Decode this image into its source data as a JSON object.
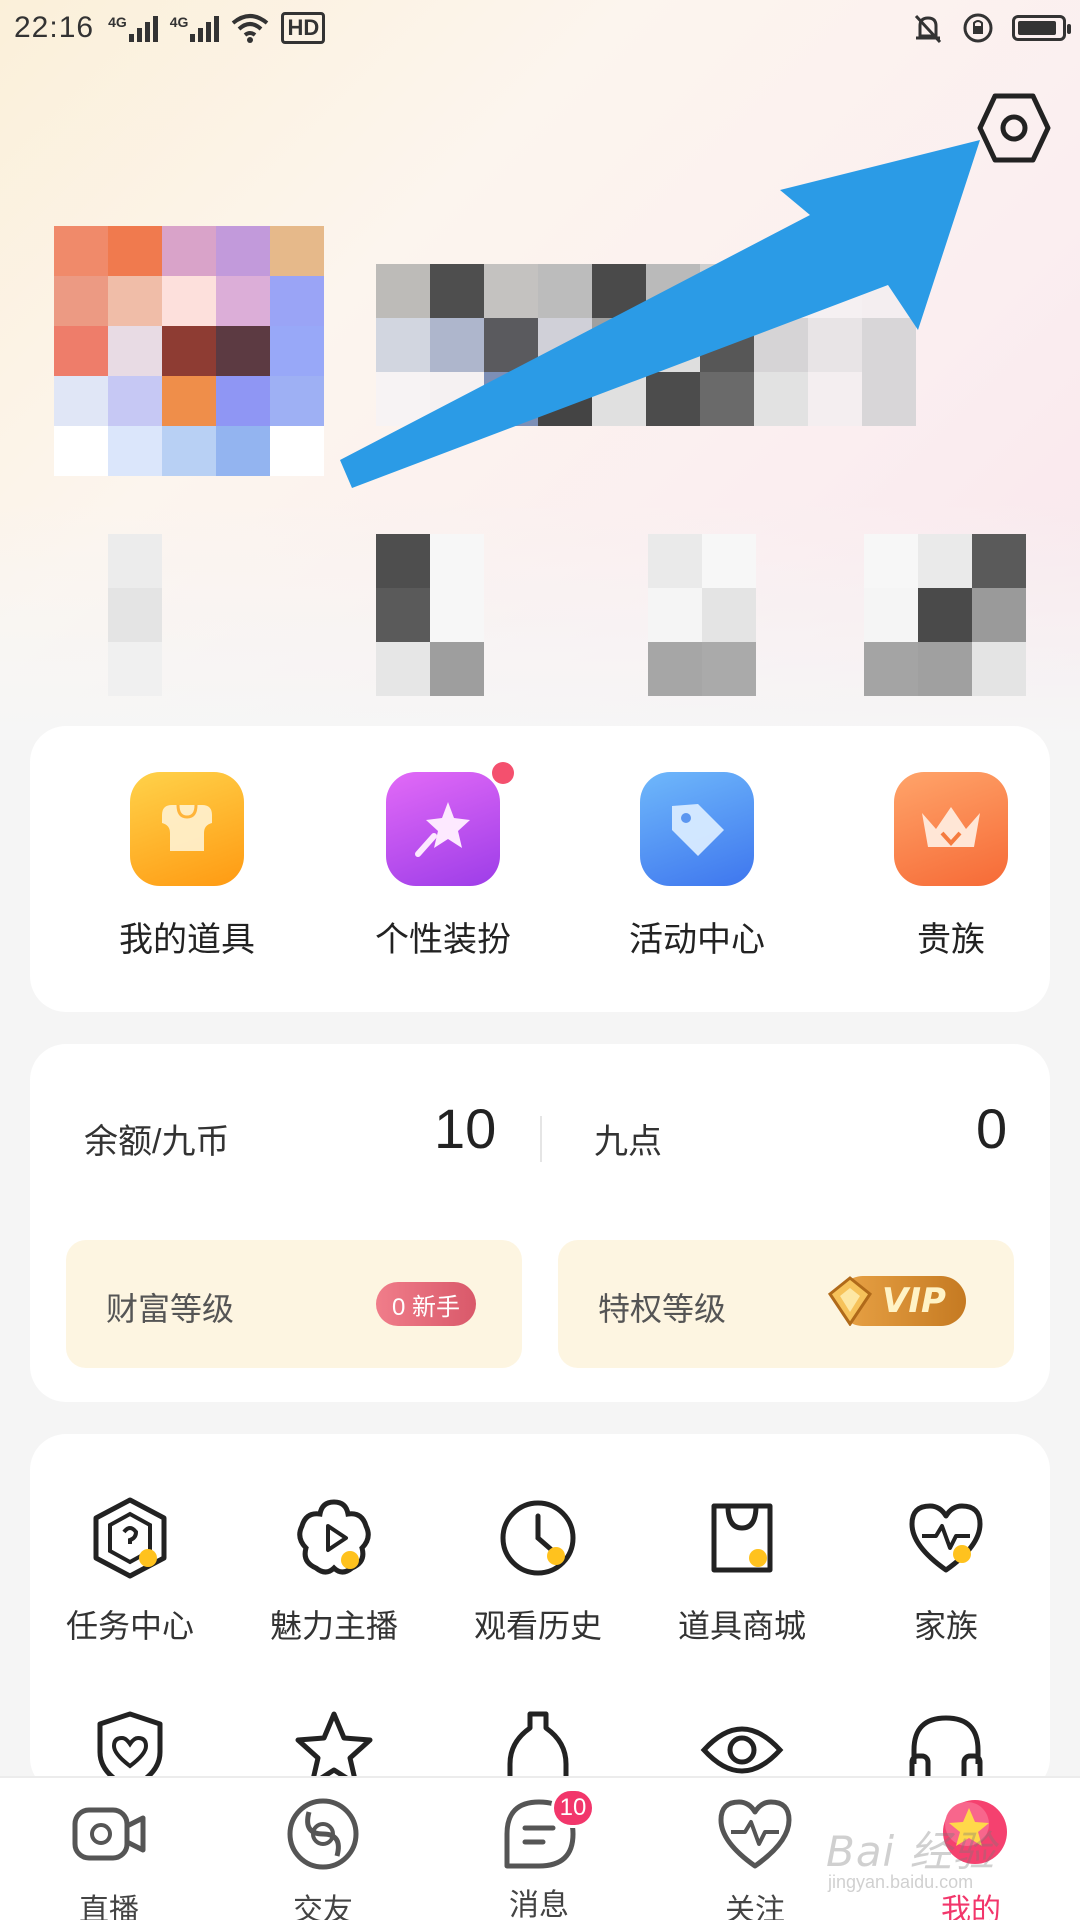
{
  "status_bar": {
    "time": "22:16",
    "network_1": "4G",
    "network_2": "4G",
    "hd": "HD"
  },
  "header": {
    "settings_icon": "hexagon-gear-icon",
    "annotation": "blue-arrow-pointing-to-settings"
  },
  "top_shortcuts": [
    {
      "label": "我的道具",
      "icon": "bag-icon",
      "color": "#ffb21e"
    },
    {
      "label": "个性装扮",
      "icon": "magic-wand-icon",
      "color": "#b14cf0",
      "has_dot": true
    },
    {
      "label": "活动中心",
      "icon": "tag-icon",
      "color": "#4a8df6"
    },
    {
      "label": "贵族",
      "icon": "crown-icon",
      "color": "#f97a3c"
    }
  ],
  "wallet": {
    "balance_label": "余额/九币",
    "balance_value": "10",
    "points_label": "九点",
    "points_value": "0",
    "wealth_level_label": "财富等级",
    "wealth_badge": "0 新手",
    "privilege_level_label": "特权等级",
    "vip_badge": "VIP"
  },
  "services": {
    "row1": [
      {
        "label": "任务中心",
        "icon": "task-icon"
      },
      {
        "label": "魅力主播",
        "icon": "star-flower-play-icon"
      },
      {
        "label": "观看历史",
        "icon": "clock-icon"
      },
      {
        "label": "道具商城",
        "icon": "shopping-bag-icon"
      },
      {
        "label": "家族",
        "icon": "heart-pulse-icon"
      }
    ]
  },
  "tab_bar": {
    "items": [
      {
        "label": "直播",
        "icon": "camera-icon"
      },
      {
        "label": "交友",
        "icon": "planet-icon"
      },
      {
        "label": "消息",
        "icon": "chat-icon",
        "badge": "10"
      },
      {
        "label": "关注",
        "icon": "heart-pulse-icon"
      },
      {
        "label": "我的",
        "icon": "star-icon",
        "active": true
      }
    ]
  },
  "watermark": {
    "text": "Bai 经验",
    "sub": "jingyan.baidu.com"
  },
  "colors": {
    "accent_pink": "#f2366b",
    "arrow_blue": "#2b9be6",
    "level_box_bg": "#fdf5e1"
  }
}
